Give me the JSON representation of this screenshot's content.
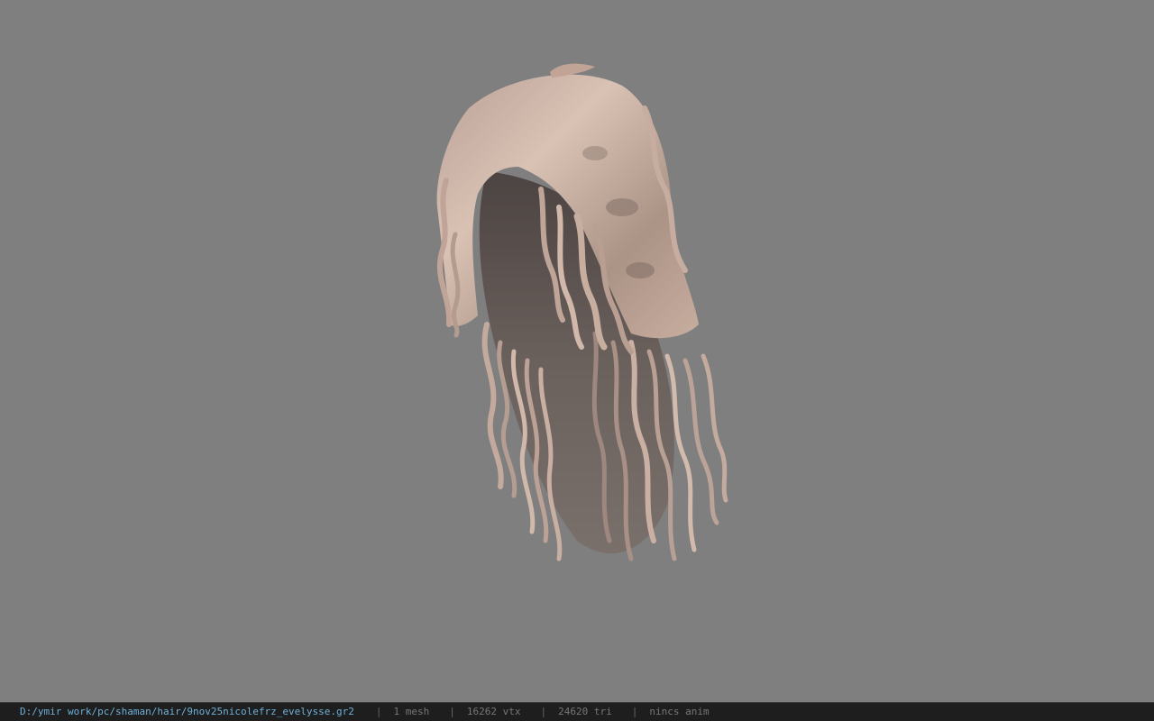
{
  "status_bar": {
    "file_path": "D:/ymir work/pc/shaman/hair/9nov25nicolefrz_evelysse.gr2",
    "separator": "|",
    "mesh_count": "1 mesh",
    "vertex_count": "16262 vtx",
    "triangle_count": "24620 tri",
    "animation": "nincs anim"
  },
  "colors": {
    "background": "#7f7f7f",
    "status_bar_bg": "#1e1e1e",
    "path_text": "#6fb0d8",
    "stat_text": "#777777",
    "hair_light": "#cdb3a4",
    "hair_mid": "#a88f84",
    "hair_dark": "#5e5350"
  },
  "icons": {
    "model": "hair-mesh-model"
  }
}
